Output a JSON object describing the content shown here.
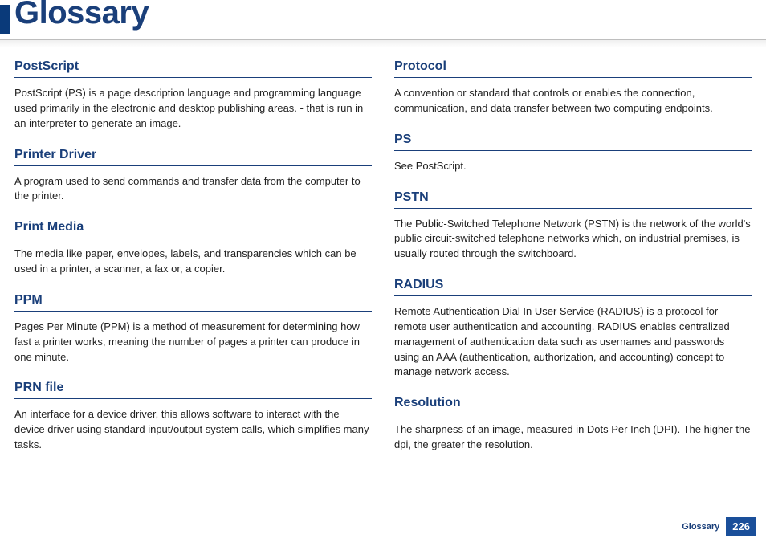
{
  "header": {
    "title": "Glossary"
  },
  "left_column": [
    {
      "term": "PostScript",
      "definition": "PostScript (PS) is a page description language and programming language used primarily in the electronic and desktop publishing areas. - that is run in an interpreter to generate an image."
    },
    {
      "term": "Printer Driver",
      "definition": "A program used to send commands and transfer data from the computer to the printer."
    },
    {
      "term": "Print Media",
      "definition": "The media like paper, envelopes, labels, and transparencies which can be used in a printer, a scanner, a fax or, a copier."
    },
    {
      "term": "PPM",
      "definition": "Pages Per Minute (PPM) is a method of measurement for determining how fast a printer works, meaning the number of pages a printer can produce in one minute."
    },
    {
      "term": "PRN file",
      "definition": "An interface for a device driver, this allows software to interact with the device driver using standard input/output system calls, which simplifies many tasks."
    }
  ],
  "right_column": [
    {
      "term": "Protocol",
      "definition": "A convention or standard that controls or enables the connection, communication, and data transfer between two computing endpoints."
    },
    {
      "term": "PS",
      "definition": "See PostScript."
    },
    {
      "term": "PSTN",
      "definition": "The Public-Switched Telephone Network (PSTN) is the network of the world's public circuit-switched telephone networks which, on industrial premises, is usually routed through the switchboard."
    },
    {
      "term": "RADIUS",
      "definition": "Remote Authentication Dial In User Service (RADIUS) is a protocol for remote user authentication and accounting. RADIUS enables centralized management of authentication data such as usernames and passwords using an AAA (authentication, authorization, and accounting) concept to manage network access."
    },
    {
      "term": "Resolution",
      "definition": "The sharpness of an image, measured in Dots Per Inch (DPI). The higher the dpi, the greater the resolution."
    }
  ],
  "footer": {
    "section": "Glossary",
    "page": "226"
  }
}
